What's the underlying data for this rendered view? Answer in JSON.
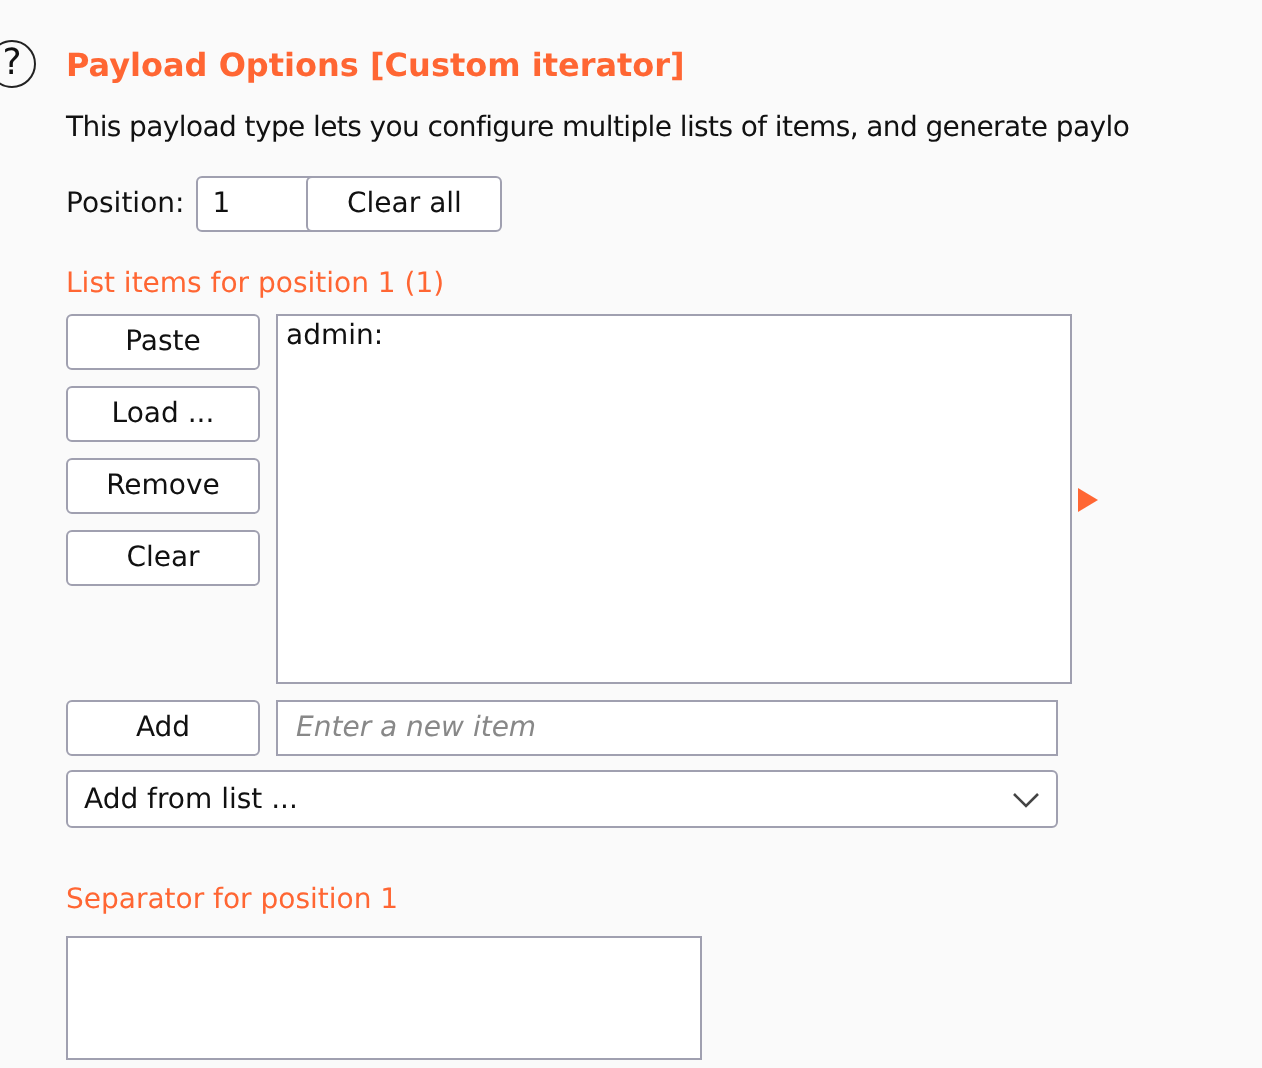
{
  "help_icon": "?",
  "title": "Payload Options [Custom iterator]",
  "description": "This payload type lets you configure multiple lists of items, and generate paylo",
  "position": {
    "label": "Position:",
    "value": "1",
    "clear_button": "Clear all"
  },
  "list_section": {
    "label": "List items for position 1 (1)",
    "buttons": [
      "Paste",
      "Load ...",
      "Remove",
      "Clear"
    ],
    "items": [
      "admin:"
    ],
    "add_button": "Add",
    "add_placeholder": "Enter a new item",
    "add_from_list": "Add from list ..."
  },
  "separator": {
    "label": "Separator for position 1"
  }
}
